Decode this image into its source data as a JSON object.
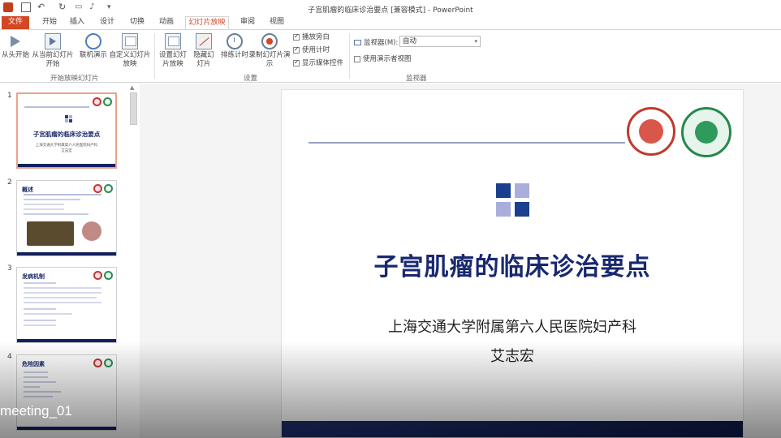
{
  "window": {
    "title": "子宫肌瘤的临床诊治要点 [兼容模式] - PowerPoint"
  },
  "ribbon_tabs": [
    "文件",
    "开始",
    "插入",
    "设计",
    "切换",
    "动画",
    "幻灯片放映",
    "审阅",
    "视图"
  ],
  "active_tab": "幻灯片放映",
  "ribbon": {
    "start_group": {
      "label": "开始放映幻灯片",
      "buttons": [
        "从头开始",
        "从当前幻灯片开始",
        "联机演示",
        "自定义幻灯片放映"
      ]
    },
    "setup_group": {
      "label": "设置",
      "buttons": [
        "设置幻灯片放映",
        "隐藏幻灯片",
        "排练计时",
        "录制幻灯片演示"
      ]
    },
    "checkboxes": [
      {
        "label": "播放旁白",
        "checked": true
      },
      {
        "label": "使用计时",
        "checked": true
      },
      {
        "label": "显示媒体控件",
        "checked": true
      }
    ],
    "monitor_group": {
      "label": "监视器",
      "monitor_label": "监视器(M):",
      "monitor_value": "自动",
      "presenter_view_label": "使用演示者视图",
      "presenter_view_checked": false
    }
  },
  "thumbnails": [
    {
      "number": "1",
      "title": "子宫肌瘤的临床诊治要点",
      "sub": "上海交通大学附属第六人民医院妇产科",
      "author": "艾志宏"
    },
    {
      "number": "2",
      "title": "概述"
    },
    {
      "number": "3",
      "title": "发病机制"
    },
    {
      "number": "4",
      "title": "危险因素"
    }
  ],
  "slide": {
    "title": "子宫肌瘤的临床诊治要点",
    "subtitle": "上海交通大学附属第六人民医院妇产科",
    "author": "艾志宏"
  },
  "overlay": {
    "label": "meeting_01"
  },
  "colors": {
    "accent": "#d24726",
    "slide_title": "#182870",
    "navy": "#14205e",
    "square_dark": "#1b3f8f",
    "square_light": "#a9aedb"
  }
}
